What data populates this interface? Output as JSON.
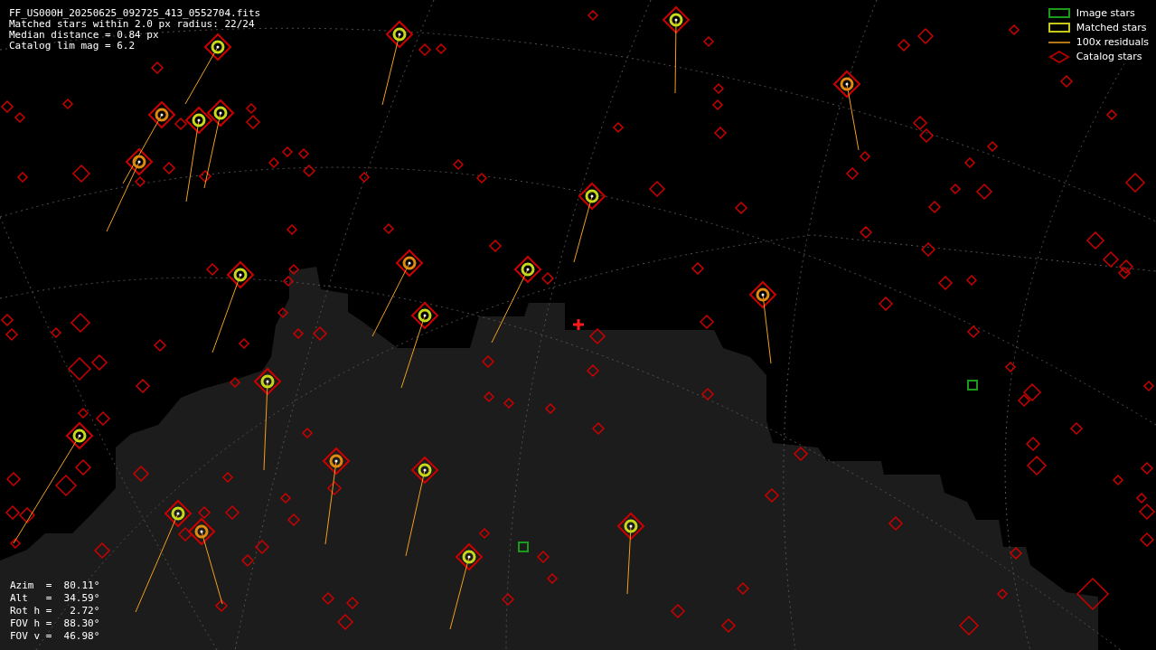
{
  "info": {
    "file_name": "FF_US000H_20250625_092725_413_0552704.fits",
    "lines": [
      "Matched stars within 2.0 px radius: 22/24",
      "Median distance = 0.84 px",
      "Catalog lim mag = 6.2"
    ]
  },
  "legend": [
    {
      "kind": "image",
      "label": "Image stars"
    },
    {
      "kind": "matched",
      "label": "Matched stars"
    },
    {
      "kind": "residual",
      "label": "100x residuals"
    },
    {
      "kind": "catalog",
      "label": "Catalog stars"
    }
  ],
  "pointing": [
    "Azim  =  80.11°",
    "Alt   =  34.59°",
    "Rot h =   2.72°",
    "FOV h =  88.30°",
    "FOV v =  46.98°"
  ]
}
